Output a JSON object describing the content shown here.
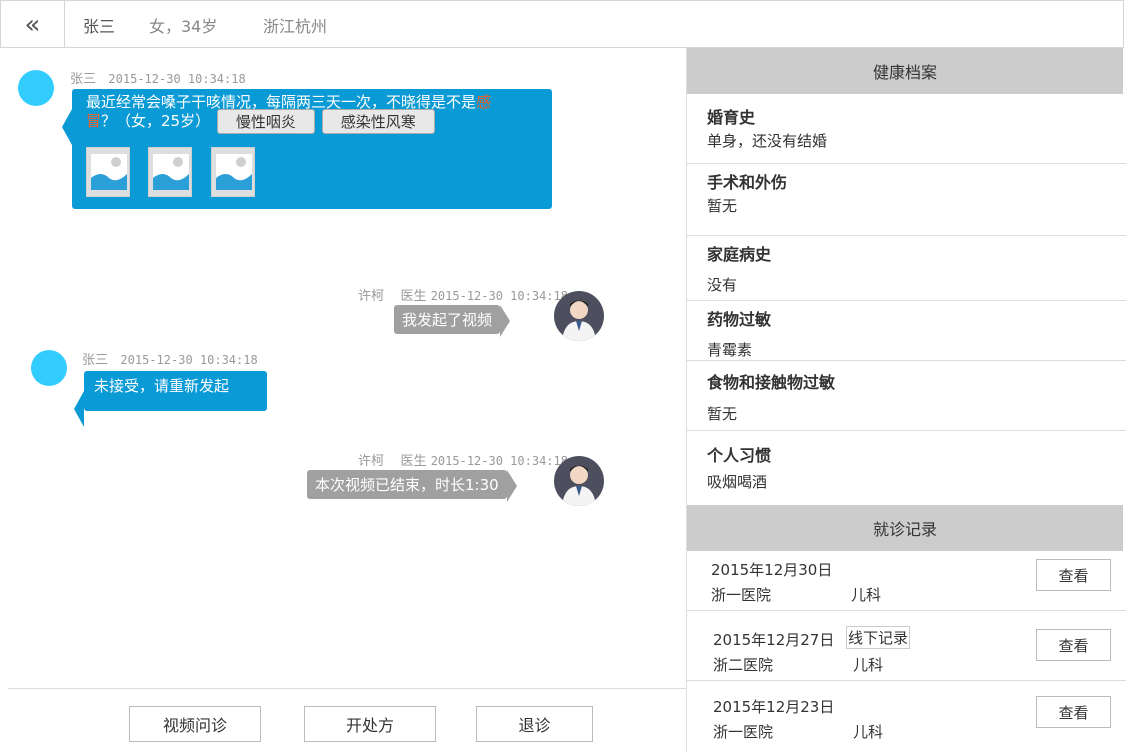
{
  "header": {
    "back_icon": "«",
    "patient_name": "张三",
    "patient_info": "女，34岁",
    "patient_location": "浙江杭州"
  },
  "chat": {
    "messages": [
      {
        "sender": "张三",
        "time": "2015-12-30 10:34:18",
        "text_line1_normal": "最近经常会嗓子干咳情况，每隔两三天一次，不晓得是不是",
        "text_line1_highlight": "感",
        "text_line2_highlight": "冒",
        "text_line2_normal": "？（女，25岁）",
        "tags": [
          "慢性咽炎",
          "感染性风寒"
        ],
        "image_icon": "image-icon"
      },
      {
        "sender": "许柯",
        "role": "医生",
        "time": "2015-12-30 10:34:18",
        "text": "我发起了视频"
      },
      {
        "sender": "张三",
        "time": "2015-12-30 10:34:18",
        "text": "未接受，请重新发起"
      },
      {
        "sender": "许柯",
        "role": "医生",
        "time": "2015-12-30 10:34:18",
        "text": "本次视频已结束，时长1:30"
      }
    ]
  },
  "actions": {
    "video": "视频问诊",
    "prescribe": "开处方",
    "exit": "退诊"
  },
  "health_record": {
    "title": "健康档案",
    "sections": [
      {
        "title": "婚育史",
        "value": "单身，还没有结婚"
      },
      {
        "title": "手术和外伤",
        "value": "暂无"
      },
      {
        "title": "家庭病史",
        "value": "没有"
      },
      {
        "title": "药物过敏",
        "value": "青霉素"
      },
      {
        "title": "食物和接触物过敏",
        "value": "暂无"
      },
      {
        "title": "个人习惯",
        "value": "吸烟喝酒"
      }
    ]
  },
  "visits": {
    "title": "就诊记录",
    "view_label": "查看",
    "items": [
      {
        "date": "2015年12月30日",
        "hospital": "浙一医院",
        "dept": "儿科",
        "tag": ""
      },
      {
        "date": "2015年12月27日",
        "hospital": "浙二医院",
        "dept": "儿科",
        "tag": "线下记录"
      },
      {
        "date": "2015年12月23日",
        "hospital": "浙一医院",
        "dept": "儿科",
        "tag": ""
      }
    ]
  },
  "colors": {
    "patient_bubble": "#0a9ad6",
    "doctor_bubble": "#a0a0a0",
    "avatar": "#33ccff",
    "highlight_text": "#e8632a",
    "panel_header": "#cccccc"
  }
}
